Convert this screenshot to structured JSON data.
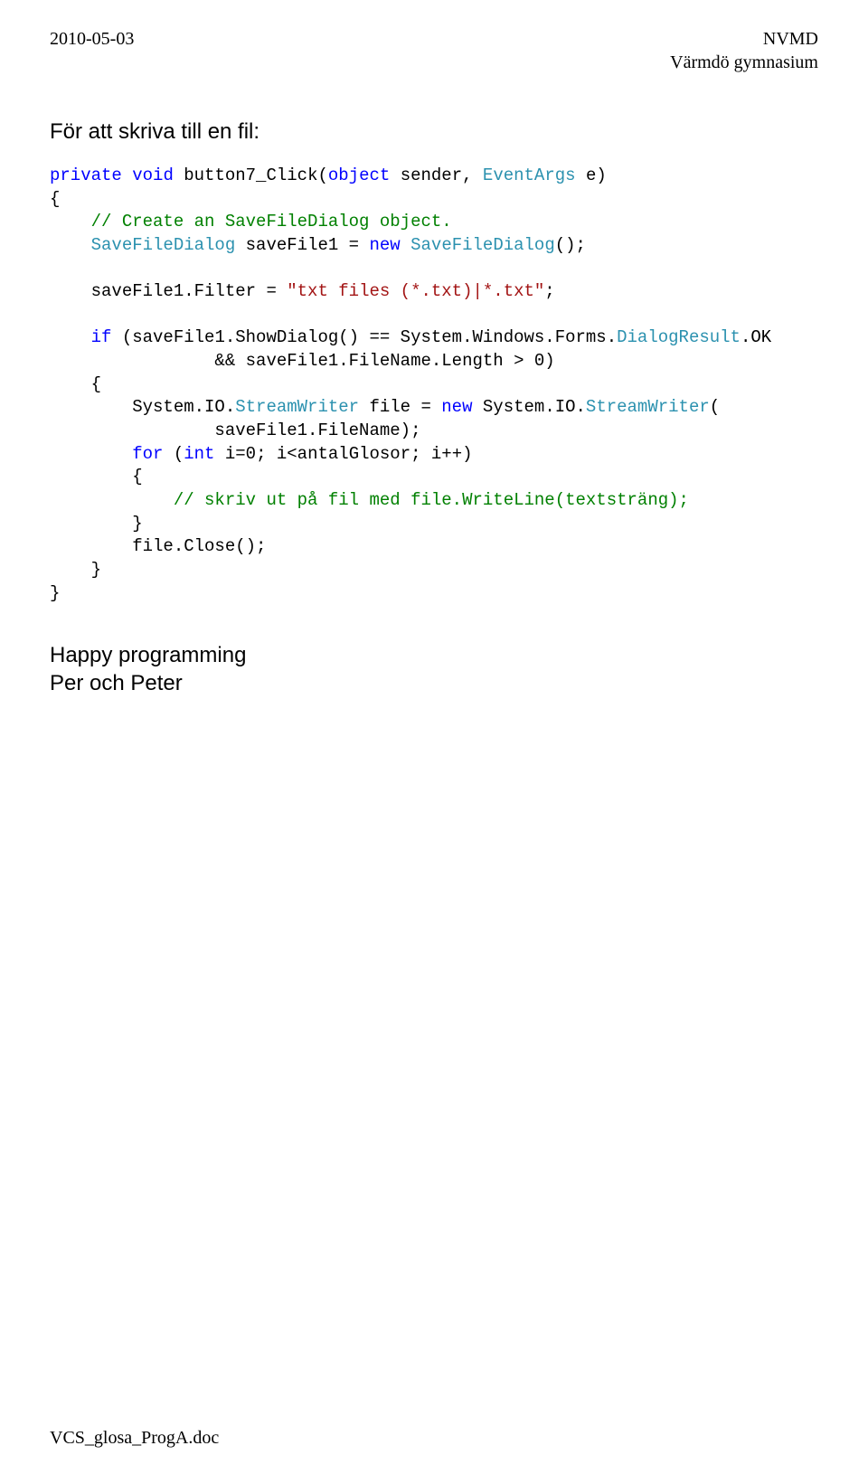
{
  "header": {
    "date": "2010-05-03",
    "org1": "NVMD",
    "org2": "Värmdö gymnasium"
  },
  "section_heading": "För att skriva till en fil:",
  "code": {
    "l1a": "private",
    "l1b": " ",
    "l1c": "void",
    "l1d": " button7_Click(",
    "l1e": "object",
    "l1f": " sender, ",
    "l1g": "EventArgs",
    "l1h": " e)",
    "l2": "{",
    "l3a": "    ",
    "l3b": "// Create an SaveFileDialog object.",
    "l4a": "    ",
    "l4b": "SaveFileDialog",
    "l4c": " saveFile1 = ",
    "l4d": "new",
    "l4e": " ",
    "l4f": "SaveFileDialog",
    "l4g": "();",
    "l5": " ",
    "l6a": "    saveFile1.Filter = ",
    "l6b": "\"txt files (*.txt)|*.txt\"",
    "l6c": ";",
    "l7": " ",
    "l8a": "    ",
    "l8b": "if",
    "l8c": " (saveFile1.ShowDialog() == System.Windows.Forms.",
    "l8d": "DialogResult",
    "l8e": ".OK",
    "l9": "                && saveFile1.FileName.Length > 0)",
    "l10": "    {",
    "l11a": "        System.IO.",
    "l11b": "StreamWriter",
    "l11c": " file = ",
    "l11d": "new",
    "l11e": " System.IO.",
    "l11f": "StreamWriter",
    "l11g": "(",
    "l12": "                saveFile1.FileName);",
    "l13a": "        ",
    "l13b": "for",
    "l13c": " (",
    "l13d": "int",
    "l13e": " i=0; i<antalGlosor; i++)",
    "l14": "        {",
    "l15a": "            ",
    "l15b": "// skriv ut på fil med file.WriteLine(textsträng);",
    "l16": "        }",
    "l17": "        file.Close();",
    "l18": "    }",
    "l19": "}"
  },
  "closing": {
    "line1": "Happy programming",
    "line2": "Per och Peter"
  },
  "footer": "VCS_glosa_ProgA.doc"
}
